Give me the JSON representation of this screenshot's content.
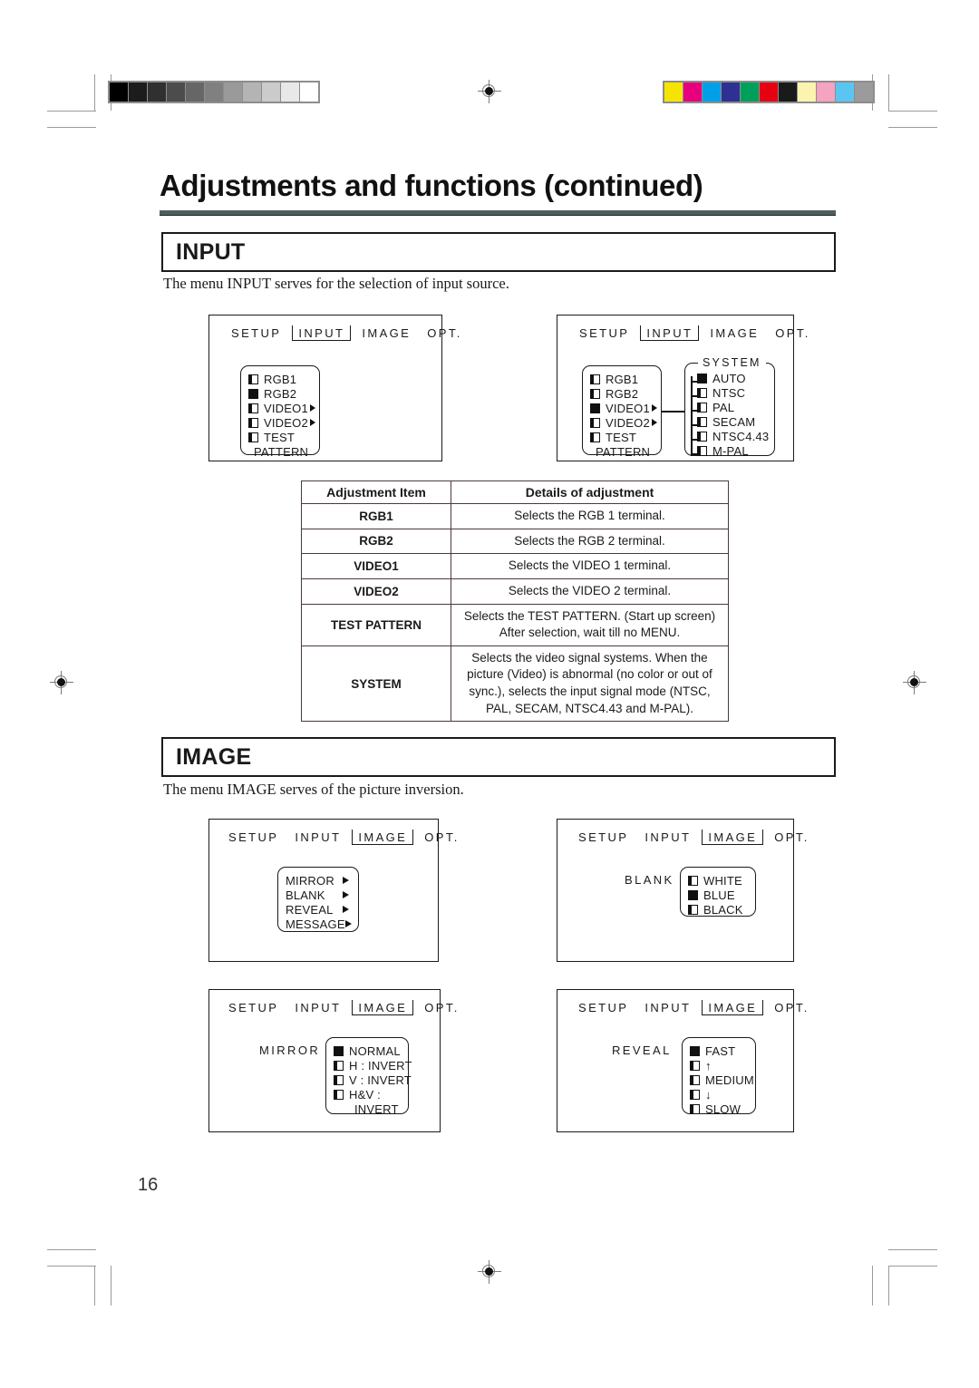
{
  "page": {
    "title": "Adjustments and functions (continued)",
    "number": "16"
  },
  "sections": [
    {
      "heading": "INPUT",
      "intro": "The menu INPUT serves for the selection of input source."
    },
    {
      "heading": "IMAGE",
      "intro": "The menu IMAGE serves of the picture inversion."
    }
  ],
  "osd": {
    "tabs": [
      "SETUP",
      "INPUT",
      "IMAGE",
      "OPT."
    ],
    "input_panel_1": {
      "selected_tab": "INPUT",
      "items": [
        {
          "label": "RGB1",
          "selected": false,
          "submenu": false
        },
        {
          "label": "RGB2",
          "selected": true,
          "submenu": false
        },
        {
          "label": "VIDEO1",
          "selected": false,
          "submenu": true
        },
        {
          "label": "VIDEO2",
          "selected": false,
          "submenu": true
        },
        {
          "label": "TEST",
          "selected": false,
          "submenu": false
        },
        {
          "label": "PATTERN",
          "selected": null,
          "submenu": false
        }
      ]
    },
    "input_panel_2": {
      "selected_tab": "INPUT",
      "items": [
        {
          "label": "RGB1",
          "selected": false,
          "submenu": false
        },
        {
          "label": "RGB2",
          "selected": false,
          "submenu": false
        },
        {
          "label": "VIDEO1",
          "selected": true,
          "submenu": true
        },
        {
          "label": "VIDEO2",
          "selected": false,
          "submenu": true
        },
        {
          "label": "TEST",
          "selected": false,
          "submenu": false
        },
        {
          "label": "PATTERN",
          "selected": null,
          "submenu": false
        }
      ],
      "system": {
        "title": "SYSTEM",
        "items": [
          {
            "label": "AUTO",
            "selected": true
          },
          {
            "label": "NTSC",
            "selected": false
          },
          {
            "label": "PAL",
            "selected": false
          },
          {
            "label": "SECAM",
            "selected": false
          },
          {
            "label": "NTSC4.43",
            "selected": false
          },
          {
            "label": "M-PAL",
            "selected": false
          }
        ]
      }
    },
    "image_panel_menu": {
      "selected_tab": "IMAGE",
      "items": [
        {
          "label": "MIRROR"
        },
        {
          "label": "BLANK"
        },
        {
          "label": "REVEAL"
        },
        {
          "label": "MESSAGE"
        }
      ]
    },
    "image_panel_blank": {
      "selected_tab": "IMAGE",
      "group_label": "BLANK",
      "items": [
        {
          "label": "WHITE",
          "selected": false
        },
        {
          "label": "BLUE",
          "selected": true
        },
        {
          "label": "BLACK",
          "selected": false
        }
      ]
    },
    "image_panel_mirror": {
      "selected_tab": "IMAGE",
      "group_label": "MIRROR",
      "items": [
        {
          "label": "NORMAL",
          "selected": true,
          "indent": false
        },
        {
          "label": "H : INVERT",
          "selected": false,
          "indent": false
        },
        {
          "label": "V : INVERT",
          "selected": false,
          "indent": false
        },
        {
          "label": "H&V :",
          "selected": false,
          "indent": false
        },
        {
          "label": "INVERT",
          "selected": null,
          "indent": true
        }
      ]
    },
    "image_panel_reveal": {
      "selected_tab": "IMAGE",
      "group_label": "REVEAL",
      "items": [
        {
          "label": "FAST",
          "selected": true
        },
        {
          "label": "↑",
          "selected": false
        },
        {
          "label": "MEDIUM",
          "selected": false
        },
        {
          "label": "↓",
          "selected": false
        },
        {
          "label": "SLOW",
          "selected": false
        }
      ]
    }
  },
  "table": {
    "headers": [
      "Adjustment Item",
      "Details of adjustment"
    ],
    "rows": [
      {
        "item": "RGB1",
        "detail": "Selects the RGB 1 terminal."
      },
      {
        "item": "RGB2",
        "detail": "Selects the RGB 2 terminal."
      },
      {
        "item": "VIDEO1",
        "detail": "Selects the VIDEO 1 terminal."
      },
      {
        "item": "VIDEO2",
        "detail": "Selects the VIDEO 2 terminal."
      },
      {
        "item": "TEST PATTERN",
        "detail": "Selects the TEST PATTERN. (Start up screen) After selection, wait till no MENU."
      },
      {
        "item": "SYSTEM",
        "detail": "Selects the video signal systems. When the picture (Video) is abnormal (no color or out of sync.), selects the input signal mode (NTSC, PAL, SECAM, NTSC4.43 and M-PAL)."
      }
    ]
  },
  "print_marks": {
    "grayscale_steps": [
      "#000000",
      "#1c1c1c",
      "#303030",
      "#4c4c4c",
      "#666666",
      "#808080",
      "#9a9a9a",
      "#b4b4b4",
      "#cbcbcb",
      "#e8e8e8",
      "#ffffff"
    ],
    "color_steps": [
      "#f5e400",
      "#e6007e",
      "#00a0e9",
      "#2e3192",
      "#00a05a",
      "#e60012",
      "#1a1a1a",
      "#fbf4ae",
      "#f4a3c0",
      "#5bc5f2",
      "#9b9b9b"
    ]
  }
}
